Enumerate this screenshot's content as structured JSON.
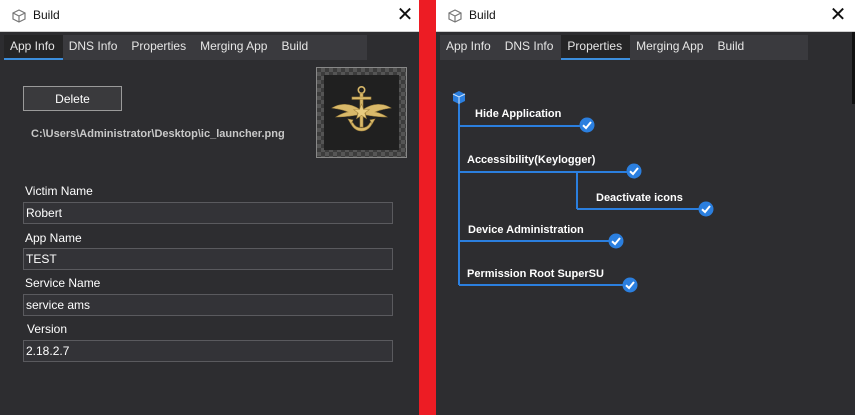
{
  "left_window": {
    "title": "Build",
    "close_glyph": "✕",
    "tabs": [
      {
        "label": "App Info",
        "active": true
      },
      {
        "label": "DNS Info",
        "active": false
      },
      {
        "label": "Properties",
        "active": false
      },
      {
        "label": "Merging App",
        "active": false
      },
      {
        "label": "Build",
        "active": false
      }
    ],
    "delete_label": "Delete",
    "icon_path": "C:\\Users\\Administrator\\Desktop\\ic_launcher.png",
    "fields": [
      {
        "label": "Victim Name",
        "value": "Robert"
      },
      {
        "label": "App Name",
        "value": "TEST"
      },
      {
        "label": "Service Name",
        "value": "service ams"
      },
      {
        "label": "Version",
        "value": "2.18.2.7"
      }
    ]
  },
  "right_window": {
    "title": "Build",
    "close_glyph": "✕",
    "tabs": [
      {
        "label": "App Info",
        "active": false
      },
      {
        "label": "DNS Info",
        "active": false
      },
      {
        "label": "Properties",
        "active": true
      },
      {
        "label": "Merging App",
        "active": false
      },
      {
        "label": "Build",
        "active": false
      }
    ],
    "properties": [
      {
        "label": "Hide Application",
        "checked": true
      },
      {
        "label": "Accessibility(Keylogger)",
        "checked": true
      },
      {
        "label": "Deactivate icons",
        "checked": true
      },
      {
        "label": "Device Administration",
        "checked": true
      },
      {
        "label": "Permission Root SuperSU",
        "checked": true
      }
    ]
  },
  "colors": {
    "divider": "#ed1c24",
    "background": "#2d2d30",
    "accent": "#3c8edc",
    "check": "#2b7fdf"
  },
  "icons": {
    "title_icon": "cube-outline-icon",
    "close_icon": "close-icon",
    "app_icon": "navy-anchor-emblem-icon",
    "tree_root": "cube-icon",
    "checkmark": "checkmark-circle-icon"
  }
}
